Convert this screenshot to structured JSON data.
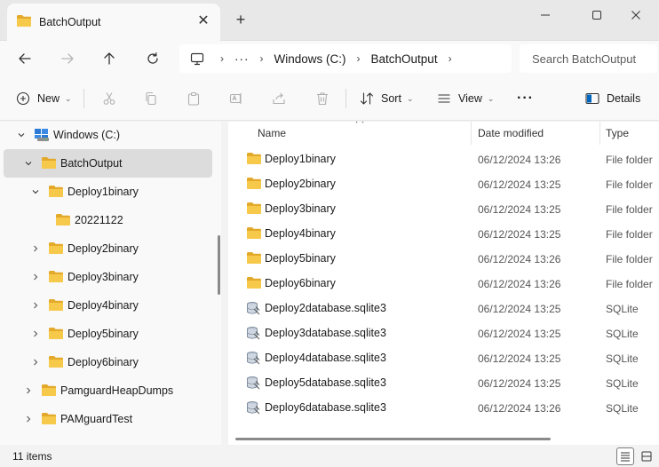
{
  "tab": {
    "title": "BatchOutput",
    "close_glyph": "✕",
    "new_tab_glyph": "+"
  },
  "window_controls": {
    "minimize": "minimize-icon",
    "maximize": "maximize-icon",
    "close": "close-icon"
  },
  "address": {
    "root_icon": "computer-icon",
    "overflow": "···",
    "crumbs": [
      "Windows (C:)",
      "BatchOutput"
    ],
    "search_placeholder": "Search BatchOutput"
  },
  "toolbar": {
    "new_label": "New",
    "sort_label": "Sort",
    "view_label": "View",
    "more_glyph": "···",
    "details_label": "Details"
  },
  "nav_tree": [
    {
      "label": "Windows (C:)",
      "icon": "drive-icon",
      "expanded": true
    },
    {
      "label": "BatchOutput",
      "icon": "folder-icon",
      "expanded": true,
      "selected": true
    },
    {
      "label": "Deploy1binary",
      "icon": "folder-icon",
      "expanded": true
    },
    {
      "label": "20221122",
      "icon": "folder-icon"
    },
    {
      "label": "Deploy2binary",
      "icon": "folder-icon",
      "expanded": false
    },
    {
      "label": "Deploy3binary",
      "icon": "folder-icon",
      "expanded": false
    },
    {
      "label": "Deploy4binary",
      "icon": "folder-icon",
      "expanded": false
    },
    {
      "label": "Deploy5binary",
      "icon": "folder-icon",
      "expanded": false
    },
    {
      "label": "Deploy6binary",
      "icon": "folder-icon",
      "expanded": false
    },
    {
      "label": "PamguardHeapDumps",
      "icon": "folder-icon",
      "expanded": false
    },
    {
      "label": "PAMguardTest",
      "icon": "folder-icon",
      "expanded": false
    }
  ],
  "columns": {
    "name": "Name",
    "date": "Date modified",
    "type": "Type"
  },
  "files": [
    {
      "name": "Deploy1binary",
      "date": "06/12/2024 13:26",
      "type": "File folder",
      "icon": "folder-icon"
    },
    {
      "name": "Deploy2binary",
      "date": "06/12/2024 13:25",
      "type": "File folder",
      "icon": "folder-icon"
    },
    {
      "name": "Deploy3binary",
      "date": "06/12/2024 13:25",
      "type": "File folder",
      "icon": "folder-icon"
    },
    {
      "name": "Deploy4binary",
      "date": "06/12/2024 13:25",
      "type": "File folder",
      "icon": "folder-icon"
    },
    {
      "name": "Deploy5binary",
      "date": "06/12/2024 13:26",
      "type": "File folder",
      "icon": "folder-icon"
    },
    {
      "name": "Deploy6binary",
      "date": "06/12/2024 13:26",
      "type": "File folder",
      "icon": "folder-icon"
    },
    {
      "name": "Deploy2database.sqlite3",
      "date": "06/12/2024 13:25",
      "type": "SQLite",
      "icon": "database-icon"
    },
    {
      "name": "Deploy3database.sqlite3",
      "date": "06/12/2024 13:25",
      "type": "SQLite",
      "icon": "database-icon"
    },
    {
      "name": "Deploy4database.sqlite3",
      "date": "06/12/2024 13:25",
      "type": "SQLite",
      "icon": "database-icon"
    },
    {
      "name": "Deploy5database.sqlite3",
      "date": "06/12/2024 13:25",
      "type": "SQLite",
      "icon": "database-icon"
    },
    {
      "name": "Deploy6database.sqlite3",
      "date": "06/12/2024 13:26",
      "type": "SQLite",
      "icon": "database-icon"
    }
  ],
  "status": {
    "item_count": "11 items"
  },
  "colors": {
    "folder": "#f7c94a",
    "folder_dark": "#e3a92b",
    "accent": "#0067c0"
  }
}
